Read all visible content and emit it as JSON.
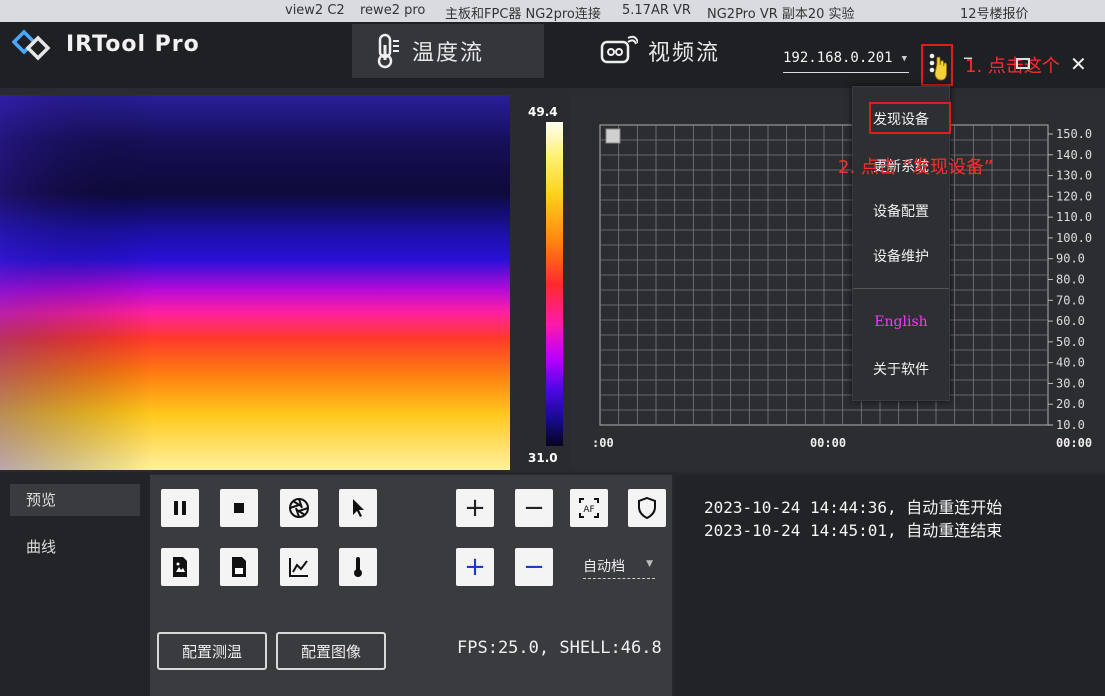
{
  "taskbar": {
    "items": [
      "view2 C2",
      "rewe2 pro",
      "主板和FPC器 NG2pro连接",
      "5.17AR VR",
      "NG2Pro VR 副本20 实验",
      "12号楼报价"
    ]
  },
  "app": {
    "title": "IRTool Pro"
  },
  "tabs": [
    {
      "label": "温度流",
      "icon": "thermometer-icon",
      "active": true
    },
    {
      "label": "视频流",
      "icon": "camera-icon",
      "active": false
    }
  ],
  "device": {
    "ip": "192.168.0.201"
  },
  "annotations": {
    "step1": "1. 点击这个",
    "step2": "2. 点击 “发现设备”"
  },
  "menu": {
    "items": [
      "发现设备",
      "更新系统",
      "设备配置",
      "设备维护",
      "English",
      "关于软件"
    ],
    "highlight_color": "#ff33ff"
  },
  "colorbar": {
    "max": "49.4",
    "min": "31.0"
  },
  "chart_data": {
    "type": "line",
    "y_ticks": [
      "150.0",
      "140.0",
      "130.0",
      "120.0",
      "110.0",
      "100.0",
      "90.0",
      "80.0",
      "70.0",
      "60.0",
      "50.0",
      "40.0",
      "30.0",
      "20.0",
      "10.0"
    ],
    "ylim": [
      10,
      150
    ],
    "x_ticks": [
      ":00",
      "00:00",
      "00:00"
    ],
    "series": [],
    "grid": true
  },
  "sidebar": {
    "items": [
      "预览",
      "曲线"
    ],
    "active": 0
  },
  "controls": {
    "zoom_plus": "+",
    "zoom_minus": "−",
    "mode_select": "自动档",
    "config_temp": "配置测温",
    "config_image": "配置图像"
  },
  "log": {
    "lines": [
      "2023-10-24 14:44:36, 自动重连开始",
      "2023-10-24 14:45:01, 自动重连结束"
    ]
  },
  "status": {
    "fps_text": "FPS:25.0, SHELL:46.8"
  },
  "colors": {
    "accent": "#e21b1b",
    "brand": "#4aa8ff"
  }
}
